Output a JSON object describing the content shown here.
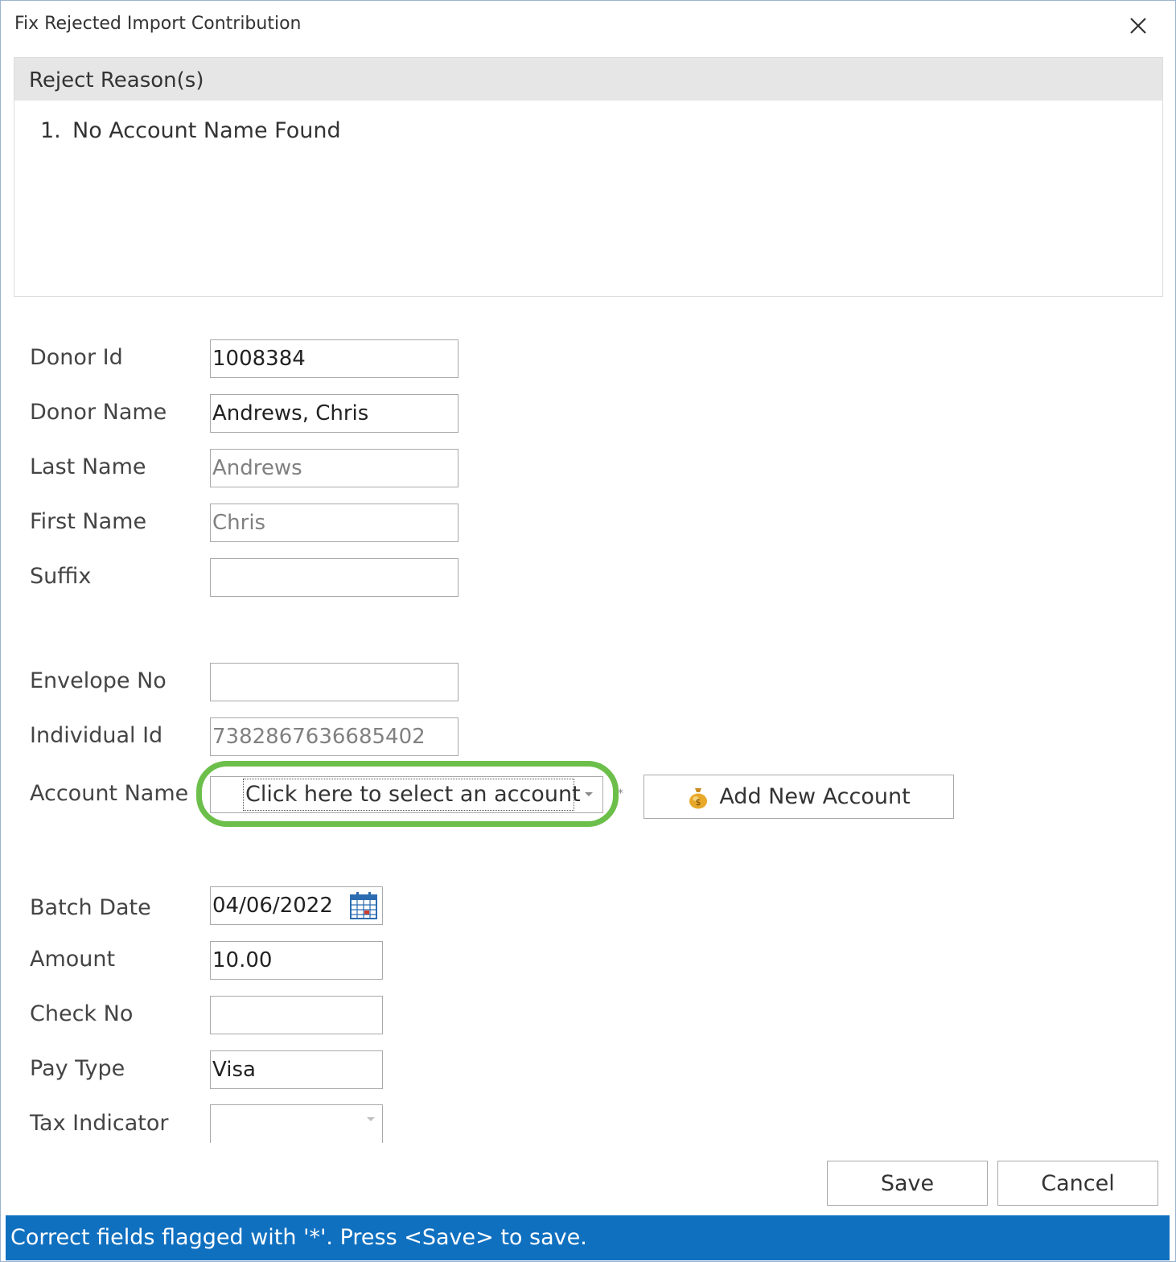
{
  "window": {
    "title": "Fix Rejected Import Contribution"
  },
  "reject_reasons": {
    "header": "Reject Reason(s)",
    "items": [
      {
        "number": "1.",
        "text": "No Account Name Found"
      }
    ]
  },
  "form": {
    "donor_id": {
      "label": "Donor Id",
      "value": "1008384"
    },
    "donor_name": {
      "label": "Donor Name",
      "value": "Andrews, Chris"
    },
    "last_name": {
      "label": "Last Name",
      "value": "Andrews"
    },
    "first_name": {
      "label": "First Name",
      "value": "Chris"
    },
    "suffix": {
      "label": "Suffix",
      "value": ""
    },
    "envelope_no": {
      "label": "Envelope No",
      "value": ""
    },
    "individual_id": {
      "label": "Individual Id",
      "value": "7382867636685402"
    },
    "account_name": {
      "label": "Account Name",
      "value": "Click here to select an account",
      "flag": "*"
    },
    "add_new_account": {
      "label": "Add New Account",
      "icon": "money-bag-icon"
    },
    "batch_date": {
      "label": "Batch Date",
      "value": "04/06/2022",
      "icon": "calendar-icon"
    },
    "amount": {
      "label": "Amount",
      "value": "10.00"
    },
    "check_no": {
      "label": "Check No",
      "value": ""
    },
    "pay_type": {
      "label": "Pay Type",
      "value": "Visa"
    },
    "tax_indicator": {
      "label": "Tax Indicator",
      "value": ""
    }
  },
  "buttons": {
    "save": "Save",
    "cancel": "Cancel"
  },
  "status": {
    "message": "Correct fields flagged with '*'. Press <Save> to save."
  },
  "colors": {
    "status_bar": "#1070c0",
    "highlight": "#6cbf4a",
    "section_header": "#e6e6e6"
  }
}
